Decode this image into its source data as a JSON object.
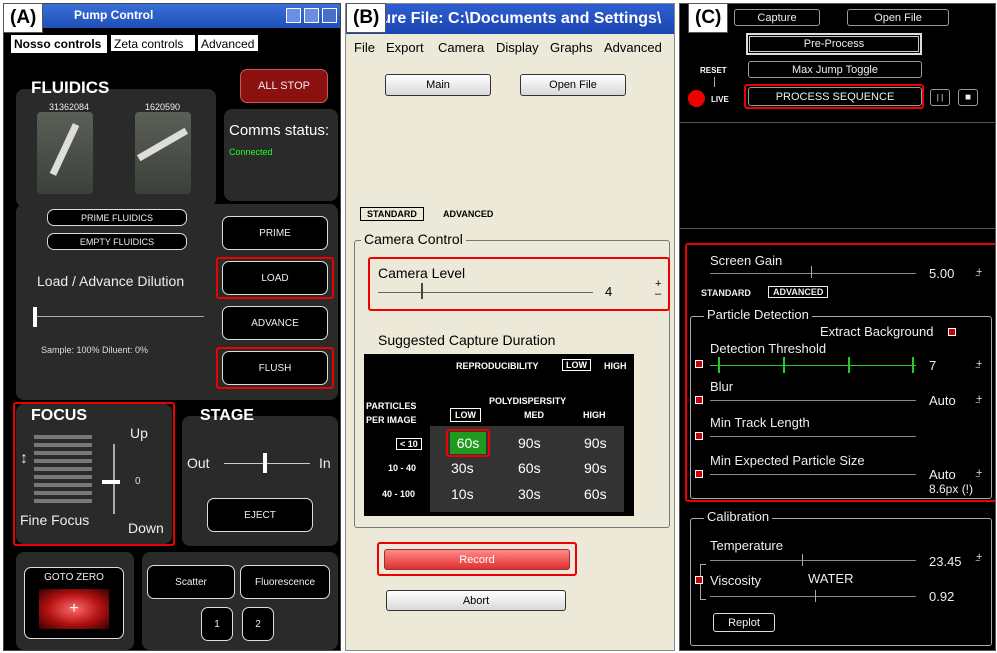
{
  "labels": {
    "a": "(A)",
    "b": "(B)",
    "c": "(C)"
  },
  "panelA": {
    "title": "Pump Control",
    "tabs": [
      "Nosso controls",
      "Zeta controls",
      "Advanced"
    ],
    "fluidics": "FLUIDICS",
    "all_stop": "ALL STOP",
    "pump1_id": "31362084",
    "pump2_id": "1620590",
    "comms_label": "Comms status:",
    "comms_value": "Connected",
    "prime_fluidics": "PRIME FLUIDICS",
    "empty_fluidics": "EMPTY FLUIDICS",
    "prime": "PRIME",
    "load": "LOAD",
    "advance": "ADVANCE",
    "flush": "FLUSH",
    "dilution_label": "Load / Advance Dilution",
    "dilution_info": "Sample: 100% Diluent: 0%",
    "focus": "FOCUS",
    "up": "Up",
    "down": "Down",
    "focus_value": "0",
    "fine_focus": "Fine Focus",
    "stage": "STAGE",
    "out": "Out",
    "in": "In",
    "eject": "EJECT",
    "goto_zero": "GOTO ZERO",
    "scatter": "Scatter",
    "fluorescence": "Fluorescence",
    "btn1": "1",
    "btn2": "2"
  },
  "panelB": {
    "title": "ture File: C:\\Documents and Settings\\",
    "menu": [
      "File",
      "Export",
      "Camera",
      "Display",
      "Graphs",
      "Advanced"
    ],
    "main": "Main",
    "open_file": "Open File",
    "standard": "STANDARD",
    "advanced": "ADVANCED",
    "camera_control": "Camera Control",
    "camera_level": "Camera Level",
    "camera_level_value": "4",
    "suggested": "Suggested Capture Duration",
    "reproducibility": "REPRODUCIBILITY",
    "low": "LOW",
    "high": "HIGH",
    "particles_per_image": "PARTICLES\nPER IMAGE",
    "polydispersity": "POLYDISPERSITY",
    "columns": [
      "LOW",
      "MED",
      "HIGH"
    ],
    "rows": [
      {
        "label": "< 10",
        "cells": [
          "60s",
          "90s",
          "90s"
        ]
      },
      {
        "label": "10 - 40",
        "cells": [
          "30s",
          "60s",
          "90s"
        ]
      },
      {
        "label": "40 - 100",
        "cells": [
          "10s",
          "30s",
          "60s"
        ]
      }
    ],
    "record": "Record",
    "abort": "Abort"
  },
  "panelC": {
    "capture": "Capture",
    "open_file": "Open File",
    "pre_process": "Pre-Process",
    "reset": "RESET",
    "live": "LIVE",
    "max_jump": "Max Jump Toggle",
    "process_sequence": "PROCESS SEQUENCE",
    "pause": "| |",
    "stop": "■",
    "screen_gain": "Screen Gain",
    "screen_gain_value": "5.00",
    "standard": "STANDARD",
    "advanced": "ADVANCED",
    "particle_detection": "Particle Detection",
    "extract_background": "Extract Background",
    "detection_threshold": "Detection Threshold",
    "detection_threshold_value": "7",
    "blur": "Blur",
    "blur_value": "Auto",
    "min_track_length": "Min Track Length",
    "min_particle_size": "Min Expected Particle Size",
    "min_particle_size_value": "Auto",
    "min_particle_size_px": "8.6px (!)",
    "calibration": "Calibration",
    "temperature": "Temperature",
    "temperature_value": "23.45",
    "viscosity": "Viscosity",
    "viscosity_type": "WATER",
    "viscosity_value": "0.92",
    "replot": "Replot"
  }
}
